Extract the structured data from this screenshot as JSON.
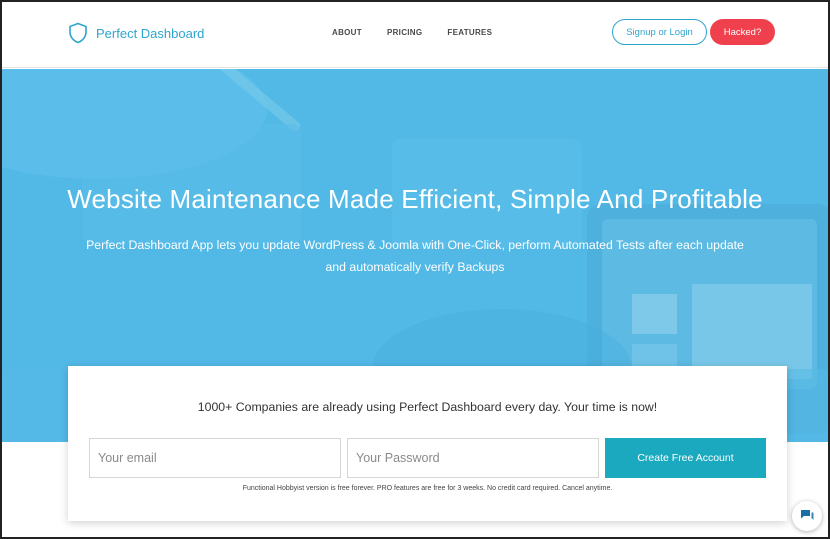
{
  "header": {
    "brand_name": "Perfect Dashboard",
    "brand_icon": "shield-icon",
    "nav": [
      {
        "label": "ABOUT"
      },
      {
        "label": "PRICING"
      },
      {
        "label": "FEATURES"
      }
    ],
    "login_label": "Signup or Login",
    "hacked_label": "Hacked?"
  },
  "hero": {
    "title": "Website Maintenance Made Efficient, Simple And Profitable",
    "subtitle_line1": "Perfect Dashboard App lets you update WordPress & Joomla with One-Click, perform Automated Tests after each update",
    "subtitle_line2": "and automatically verify Backups"
  },
  "signup": {
    "headline": "1000+ Companies are already using Perfect Dashboard every day. Your time is now!",
    "email_placeholder": "Your email",
    "email_value": "",
    "password_placeholder": "Your Password",
    "password_value": "",
    "create_label": "Create Free Account",
    "fine_print": "Functional Hobbyist version is free forever. PRO features are free for 3 weeks. No credit card required. Cancel anytime."
  },
  "chat": {
    "icon": "chat-icon"
  },
  "colors": {
    "brand": "#2fa4cf",
    "hero_bg": "#52b8e6",
    "hacked": "#f0404e",
    "cta": "#1ba9bf"
  }
}
